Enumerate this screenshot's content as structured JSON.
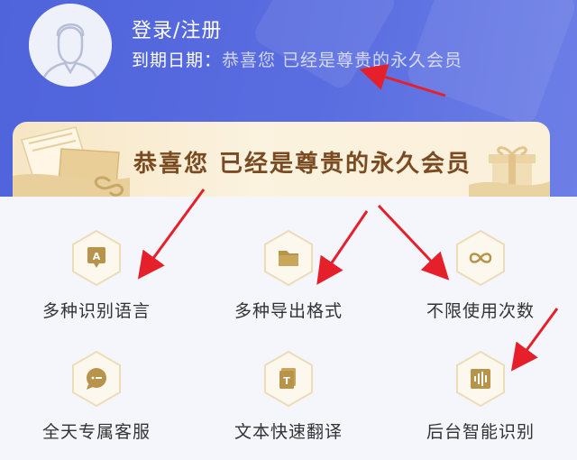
{
  "user": {
    "login_label": "登录/注册",
    "expiry_label": "到期日期：",
    "expiry_value": "恭喜您 已经是尊贵的永久会员"
  },
  "vip_banner": {
    "text": "恭喜您 已经是尊贵的永久会员"
  },
  "features": [
    {
      "label": "多种识别语言",
      "icon": "translate-a-icon"
    },
    {
      "label": "多种导出格式",
      "icon": "folder-icon"
    },
    {
      "label": "不限使用次数",
      "icon": "infinity-icon"
    },
    {
      "label": "全天专属客服",
      "icon": "chat-bubble-icon"
    },
    {
      "label": "文本快速翻译",
      "icon": "document-t-icon"
    },
    {
      "label": "后台智能识别",
      "icon": "audio-wave-icon"
    }
  ],
  "colors": {
    "header_blue": "#5468dd",
    "gold": "#b8944a",
    "vip_text": "#7a4a21",
    "annotation_red": "#e5202b"
  }
}
